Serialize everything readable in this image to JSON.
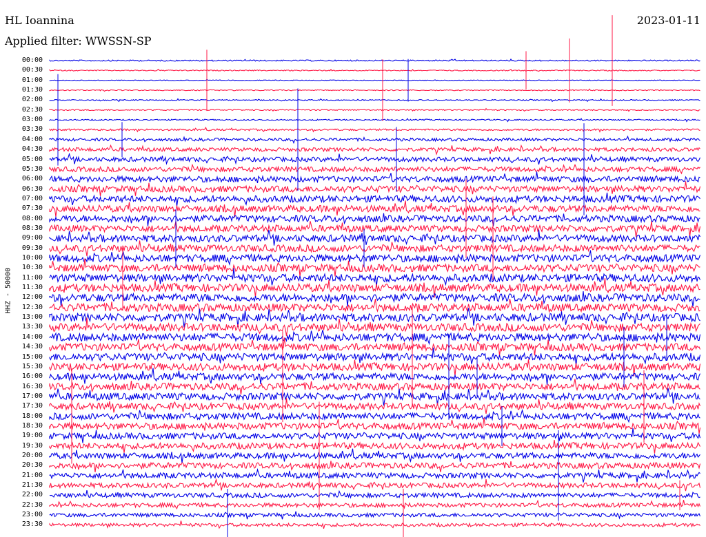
{
  "header": {
    "station": "HL Ioannina",
    "date": "2023-01-11",
    "filter": "Applied filter: WWSSN-SP"
  },
  "channel_label": "HHZ - 50000",
  "time_labels": [
    "00:00",
    "00:30",
    "01:00",
    "01:30",
    "02:00",
    "02:30",
    "03:00",
    "03:30",
    "04:00",
    "04:30",
    "05:00",
    "05:30",
    "06:00",
    "06:30",
    "07:00",
    "07:30",
    "08:00",
    "08:30",
    "09:00",
    "09:30",
    "10:00",
    "10:30",
    "11:00",
    "11:30",
    "12:00",
    "12:30",
    "13:00",
    "13:30",
    "14:00",
    "14:30",
    "15:00",
    "15:30",
    "16:00",
    "16:30",
    "17:00",
    "17:30",
    "18:00",
    "18:30",
    "19:00",
    "19:30",
    "20:00",
    "20:30",
    "21:00",
    "21:30",
    "22:00",
    "22:30",
    "23:00",
    "23:30"
  ],
  "colors": {
    "even_trace": "#0000e6",
    "odd_trace": "#ff1744",
    "text": "#000000"
  },
  "trace_amplitude": [
    0.15,
    0.12,
    0.1,
    0.12,
    0.14,
    0.14,
    0.16,
    0.22,
    0.35,
    0.45,
    0.55,
    0.6,
    0.7,
    0.75,
    0.8,
    0.8,
    0.8,
    0.8,
    0.85,
    0.85,
    0.9,
    0.9,
    0.95,
    0.95,
    0.95,
    0.95,
    0.95,
    0.95,
    0.95,
    0.9,
    0.9,
    0.9,
    0.85,
    0.85,
    0.85,
    0.8,
    0.8,
    0.8,
    0.75,
    0.75,
    0.7,
    0.7,
    0.65,
    0.6,
    0.55,
    0.5,
    0.45,
    0.4
  ]
}
